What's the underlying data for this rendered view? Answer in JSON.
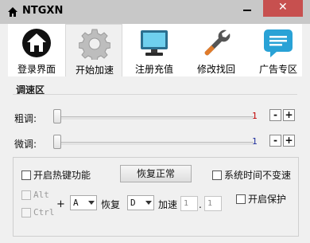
{
  "window": {
    "title": "NTGXN",
    "close_glyph": "✕",
    "icons": {
      "app": "home-icon",
      "minimize": "minimize-icon",
      "close": "close-icon"
    }
  },
  "tabs": [
    {
      "label": "登录界面",
      "icon": "house-icon",
      "active": false
    },
    {
      "label": "开始加速",
      "icon": "gear-icon",
      "active": true
    },
    {
      "label": "注册充值",
      "icon": "monitor-icon",
      "active": false
    },
    {
      "label": "修改找回",
      "icon": "wrench-icon",
      "active": false
    },
    {
      "label": "广告专区",
      "icon": "chat-bubble-icon",
      "active": false
    }
  ],
  "speed": {
    "legend": "调速区",
    "coarse": {
      "label": "粗调:",
      "value": "1",
      "value_color": "#c00000",
      "level": 0
    },
    "fine": {
      "label": "微调:",
      "value": "1",
      "value_color": "#1c2c9c",
      "level": 0
    },
    "minus": "-",
    "plus": "+"
  },
  "hotkey": {
    "enable_label": "开启热键功能",
    "restore_button": "恢复正常",
    "system_time_label": "系统时间不变速",
    "alt_label": "Alt",
    "ctrl_label": "Ctrl",
    "plus_sign": "+",
    "key1": "A",
    "restore_label": "恢复",
    "key2": "D",
    "speedup_label": "加速",
    "num1": "1",
    "dot": ".",
    "num2": "1",
    "protect_label": "开启保护"
  }
}
